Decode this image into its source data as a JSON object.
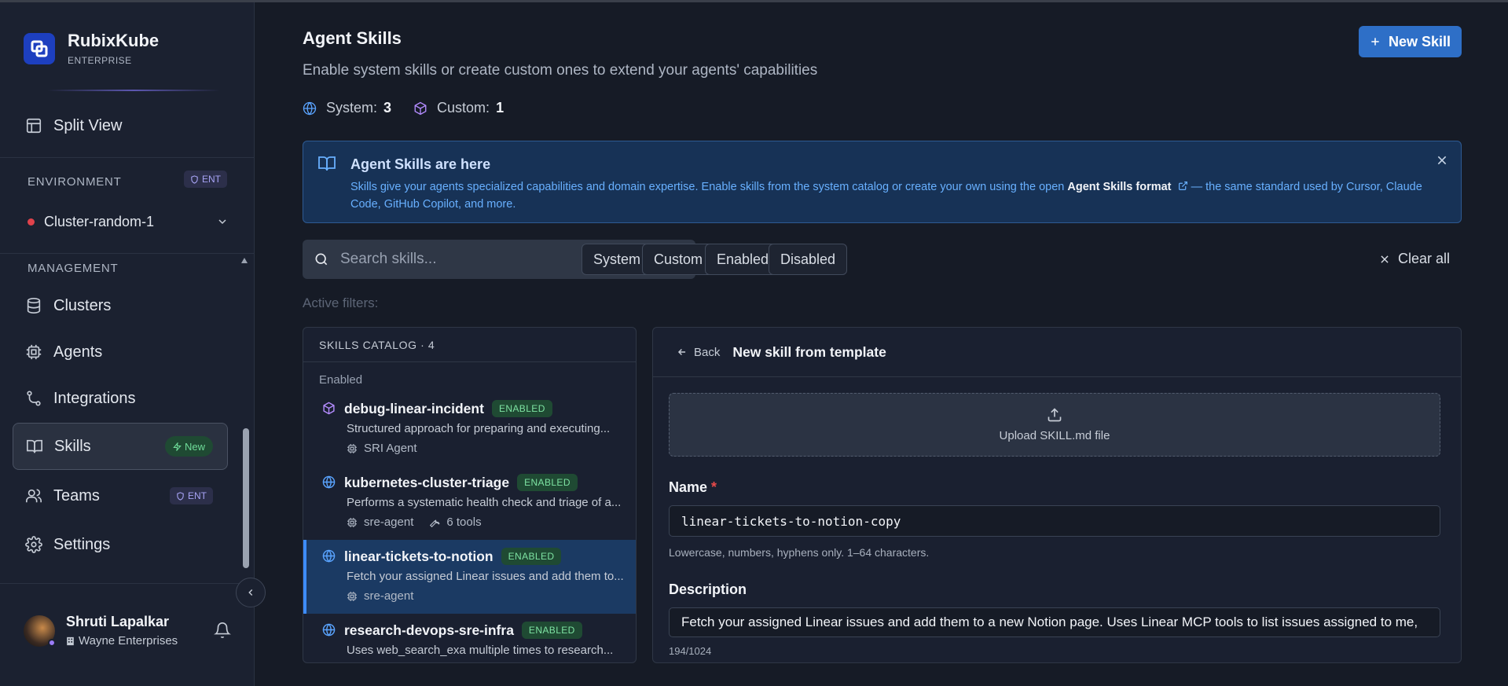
{
  "brand": {
    "name": "RubixKube",
    "tier": "ENTERPRISE"
  },
  "sidebar": {
    "split_view": "Split View",
    "environment_label": "ENVIRONMENT",
    "environment_badge": "ENT",
    "environment_value": "Cluster-random-1",
    "management_label": "MANAGEMENT",
    "items": [
      {
        "label": "Clusters"
      },
      {
        "label": "Agents"
      },
      {
        "label": "Integrations"
      },
      {
        "label": "Skills",
        "badge": "New"
      },
      {
        "label": "Teams",
        "badge": "ENT"
      },
      {
        "label": "Settings"
      }
    ],
    "user": {
      "name": "Shruti Lapalkar",
      "org": "Wayne Enterprises"
    }
  },
  "header": {
    "title": "Agent Skills",
    "subtitle": "Enable system skills or create custom ones to extend your agents' capabilities",
    "system_label": "System:",
    "system_count": "3",
    "custom_label": "Custom:",
    "custom_count": "1",
    "new_skill_label": "New Skill"
  },
  "banner": {
    "title": "Agent Skills are here",
    "text_before": "Skills give your agents specialized capabilities and domain expertise. Enable skills from the system catalog or create your own using the open ",
    "link": "Agent Skills format",
    "text_after": " — the same standard used by Cursor, Claude Code, GitHub Copilot, and more."
  },
  "filters": {
    "search_placeholder": "Search skills...",
    "chips": [
      "System",
      "Custom",
      "Enabled",
      "Disabled"
    ],
    "clear_all": "Clear all",
    "active_label": "Active filters:"
  },
  "catalog": {
    "header": "SKILLS CATALOG · 4",
    "group": "Enabled",
    "skills": [
      {
        "name": "debug-linear-incident",
        "badge": "ENABLED",
        "desc": "Structured approach for preparing and executing...",
        "agent": "SRI Agent",
        "tools": "",
        "icon": "cube-icon"
      },
      {
        "name": "kubernetes-cluster-triage",
        "badge": "ENABLED",
        "desc": "Performs a systematic health check and triage of a...",
        "agent": "sre-agent",
        "tools": "6 tools",
        "icon": "globe-icon"
      },
      {
        "name": "linear-tickets-to-notion",
        "badge": "ENABLED",
        "desc": "Fetch your assigned Linear issues and add them to...",
        "agent": "sre-agent",
        "tools": "",
        "icon": "globe-icon"
      },
      {
        "name": "research-devops-sre-infra",
        "badge": "ENABLED",
        "desc": "Uses web_search_exa multiple times to research...",
        "agent": "",
        "tools": "",
        "icon": "globe-icon"
      }
    ]
  },
  "editor": {
    "back_label": "Back",
    "title": "New skill from template",
    "upload_label": "Upload SKILL.md file",
    "name_label": "Name",
    "name_required": "*",
    "name_value": "linear-tickets-to-notion-copy",
    "name_hint": "Lowercase, numbers, hyphens only. 1–64 characters.",
    "description_label": "Description",
    "description_value": "Fetch your assigned Linear issues and add them to a new Notion page. Uses Linear MCP tools to list issues assigned to me,",
    "description_count": "194/1024"
  },
  "colors": {
    "accent": "#2e6fc7",
    "selected_row": "#1b3a63",
    "enabled_badge": "#7ee3a3"
  }
}
